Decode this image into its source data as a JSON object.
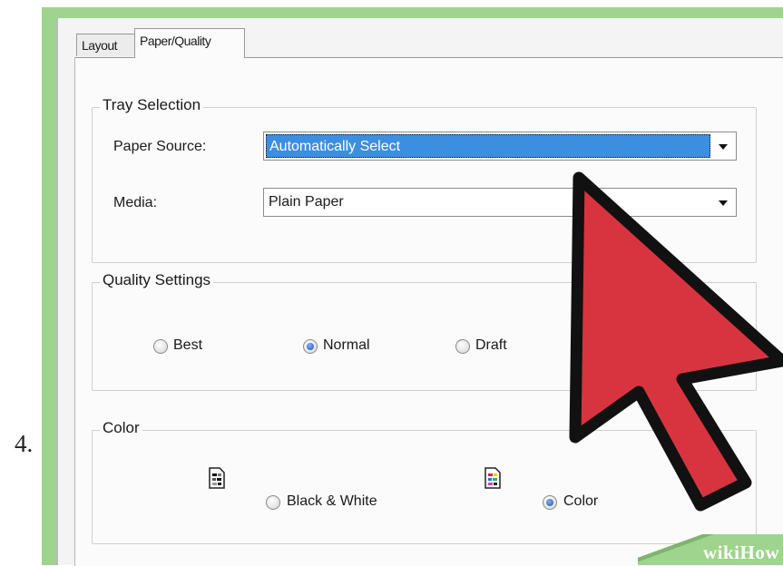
{
  "step": {
    "number": "4."
  },
  "tabs": [
    {
      "label": "Layout",
      "active": false
    },
    {
      "label": "Paper/Quality",
      "active": true
    }
  ],
  "tray_selection": {
    "title": "Tray Selection",
    "paper_source": {
      "label": "Paper Source:",
      "value": "Automatically Select"
    },
    "media": {
      "label": "Media:",
      "value": "Plain Paper"
    }
  },
  "quality_settings": {
    "title": "Quality Settings",
    "options": [
      {
        "label": "Best",
        "selected": false
      },
      {
        "label": "Normal",
        "selected": true
      },
      {
        "label": "Draft",
        "selected": false
      }
    ]
  },
  "color_settings": {
    "title": "Color",
    "options": [
      {
        "label": "Black & White",
        "selected": false,
        "icon": "black-white-document-icon"
      },
      {
        "label": "Color",
        "selected": true,
        "icon": "color-document-icon"
      }
    ]
  },
  "watermark": {
    "text": "wikiHow"
  },
  "colors": {
    "frame_green": "#9ed48d",
    "selection_blue": "#3c8ee0",
    "arrow_red": "#d8343f"
  }
}
